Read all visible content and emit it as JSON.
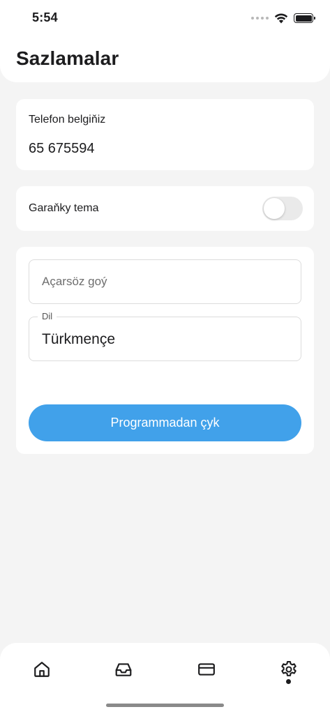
{
  "status_bar": {
    "time": "5:54",
    "icons": [
      "signal-dots-icon",
      "wifi-icon",
      "battery-icon"
    ]
  },
  "header": {
    "title": "Sazlamalar"
  },
  "phone_card": {
    "label": "Telefon belgiňiz",
    "value": "65 675594"
  },
  "theme_card": {
    "label": "Garaňky tema",
    "dark_mode_enabled": false
  },
  "form": {
    "password_placeholder": "Açarsöz goý",
    "password_value": "",
    "language_label": "Dil",
    "language_value": "Türkmençe",
    "logout_label": "Programmadan çyk"
  },
  "tab_bar": {
    "items": [
      {
        "icon": "home-icon",
        "active": false
      },
      {
        "icon": "inbox-icon",
        "active": false
      },
      {
        "icon": "credit-card-icon",
        "active": false
      },
      {
        "icon": "gear-icon",
        "active": true
      }
    ]
  },
  "colors": {
    "background": "#f4f4f4",
    "surface": "#ffffff",
    "accent": "#41a1ea",
    "text": "#1c1c1e"
  }
}
